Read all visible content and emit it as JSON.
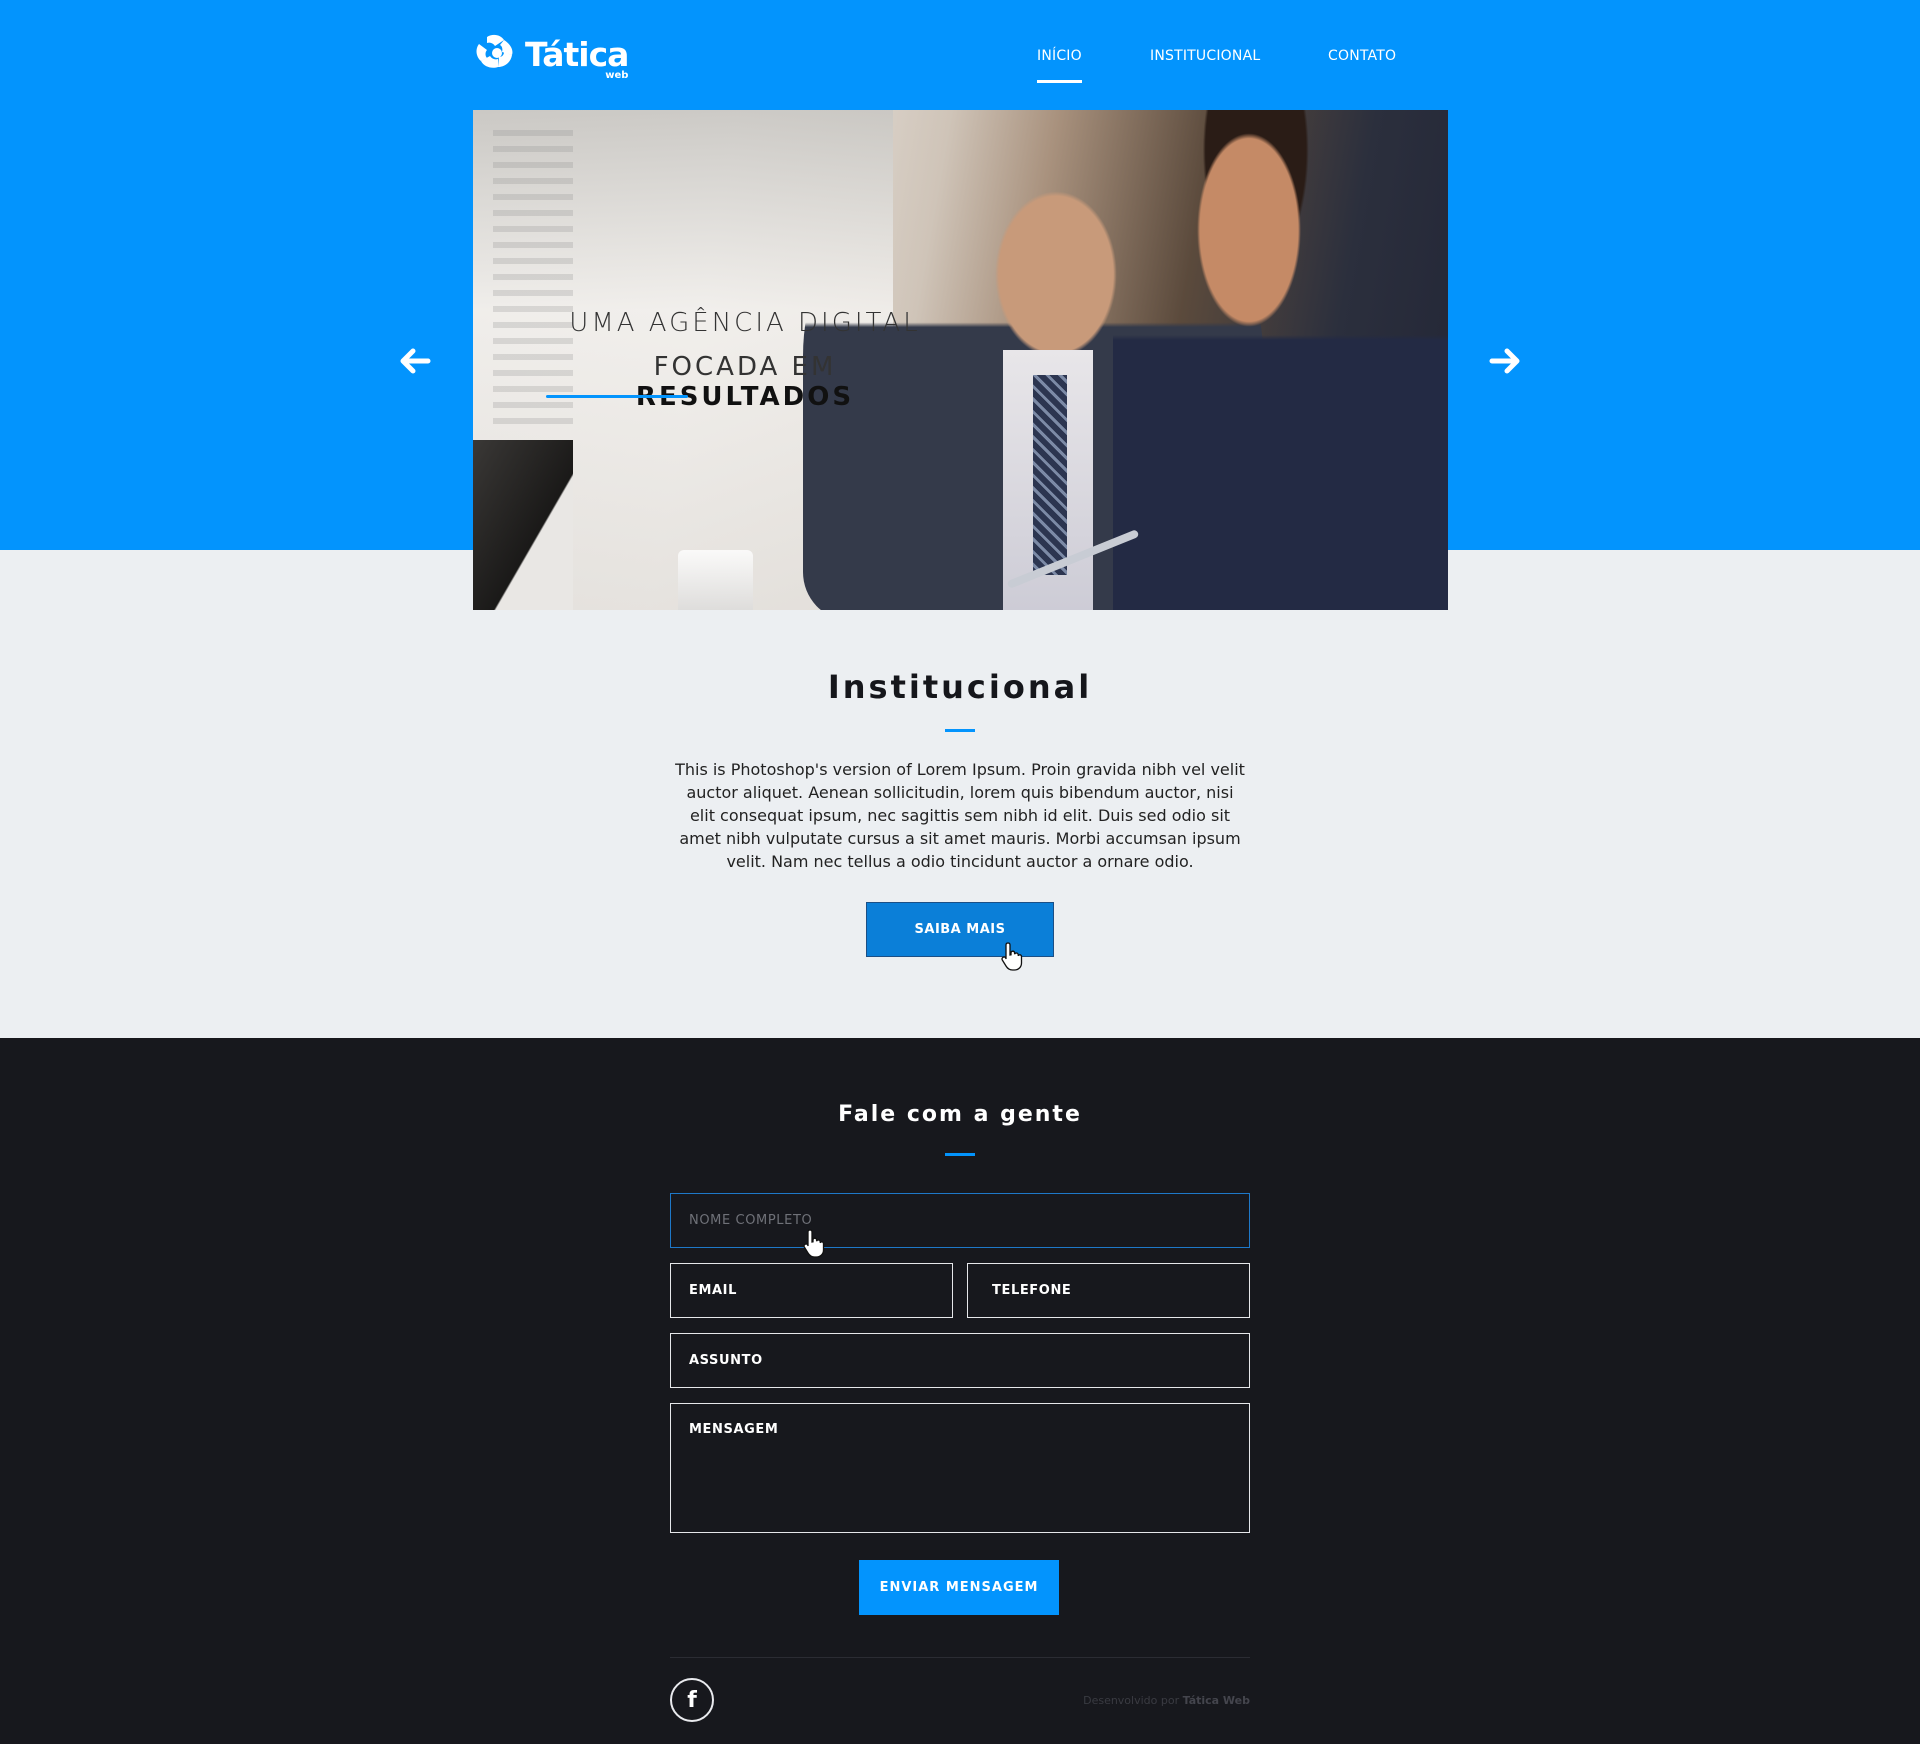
{
  "brand": {
    "name": "Tática",
    "sub": "web",
    "primary_color": "#0394fd",
    "dark_color": "#17181d",
    "light_color": "#eceff2"
  },
  "nav": {
    "items": [
      {
        "label": "INÍCIO",
        "active": true
      },
      {
        "label": "INSTITUCIONAL",
        "active": false
      },
      {
        "label": "CONTATO",
        "active": false
      }
    ]
  },
  "hero": {
    "line1": "UMA AGÊNCIA DIGITAL",
    "line2_prefix": "FOCADA EM ",
    "line2_bold": "RESULTADOS",
    "prev_icon": "arrow-left-icon",
    "next_icon": "arrow-right-icon"
  },
  "institucional": {
    "title": "Institucional",
    "body": "This is Photoshop's version  of Lorem Ipsum. Proin gravida nibh vel velit auctor aliquet. Aenean sollicitudin, lorem quis bibendum auctor, nisi elit consequat ipsum, nec sagittis sem nibh id elit. Duis sed odio sit amet nibh vulputate cursus a sit amet mauris. Morbi accumsan ipsum velit. Nam nec tellus a odio tincidunt auctor a ornare odio.",
    "button": "SAIBA MAIS"
  },
  "contact": {
    "title": "Fale com a gente",
    "name_placeholder": "NOME COMPLETO",
    "email_placeholder": "EMAIL",
    "phone_placeholder": "TELEFONE",
    "subject_placeholder": "ASSUNTO",
    "message_placeholder": "MENSAGEM",
    "button": "ENVIAR MENSAGEM"
  },
  "footer": {
    "social_icon": "facebook-icon",
    "social_glyph": "f",
    "credit_prefix": "Desenvolvido por ",
    "credit_name": "Tática Web"
  }
}
